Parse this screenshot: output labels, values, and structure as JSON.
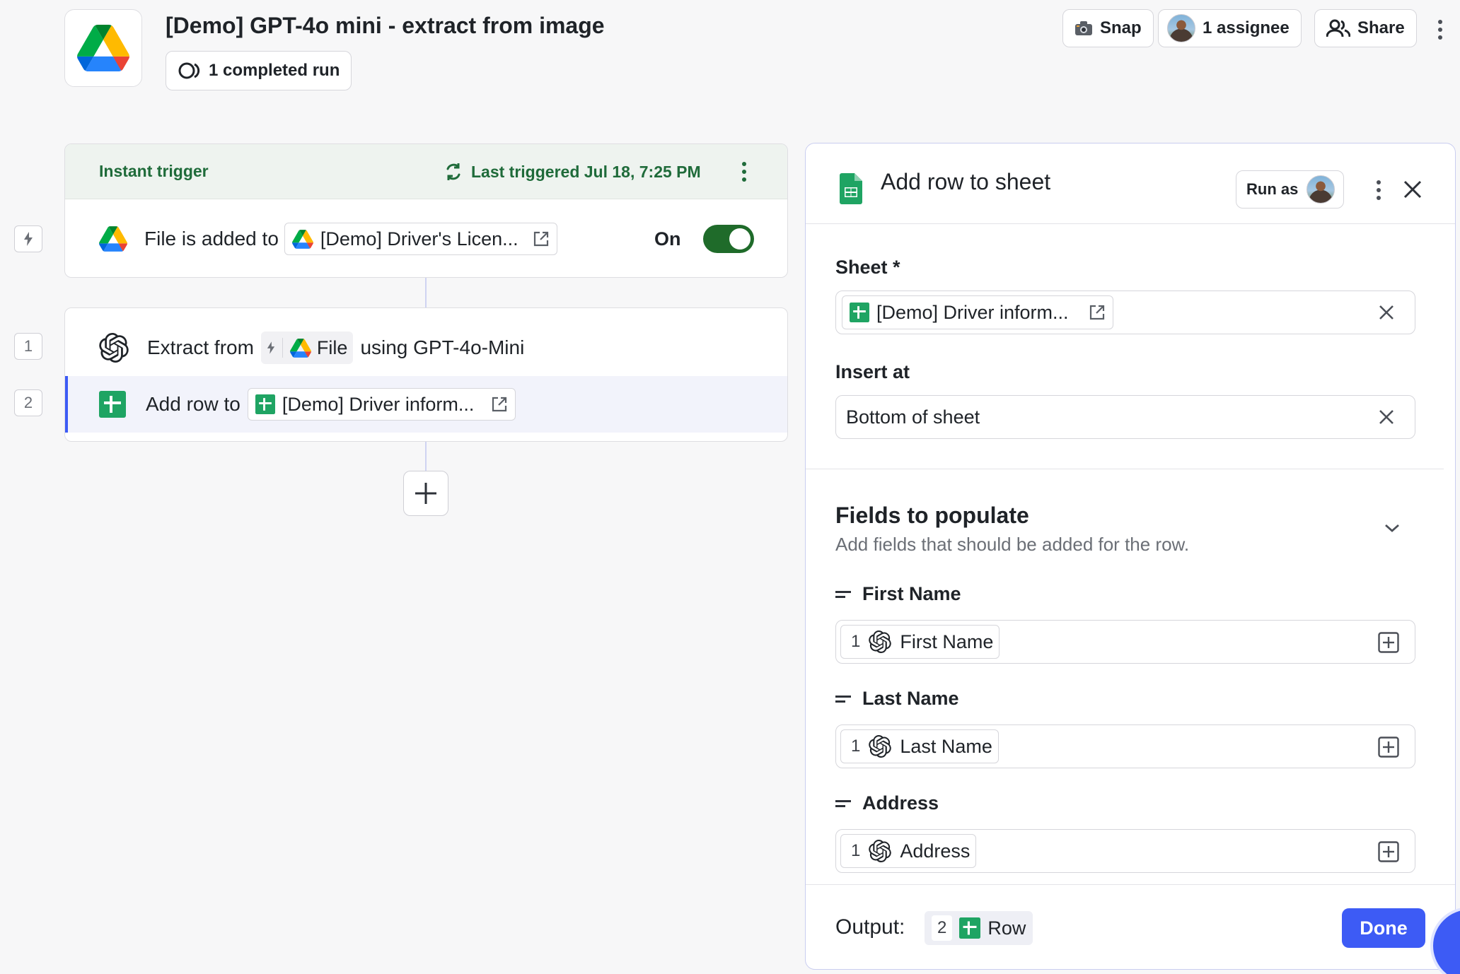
{
  "header": {
    "title": "[Demo] GPT-4o mini - extract from image",
    "runs_label": "1 completed run",
    "snap_label": "Snap",
    "assignee_label": "1 assignee",
    "share_label": "Share"
  },
  "trigger": {
    "label": "Instant trigger",
    "last_triggered": "Last triggered Jul 18, 7:25 PM",
    "step_text": "File is added to",
    "folder_chip": "[Demo] Driver's Licen...",
    "toggle_label": "On",
    "toggle_on": true
  },
  "steps": [
    {
      "number": "1",
      "prefix": "Extract from",
      "chip_label": "File",
      "suffix": "using GPT-4o-Mini"
    },
    {
      "number": "2",
      "prefix": "Add row to",
      "chip_label": "[Demo] Driver inform...",
      "active": true
    }
  ],
  "panel": {
    "title": "Add row to sheet",
    "run_as_label": "Run as",
    "sheet_label": "Sheet *",
    "sheet_value": "[Demo] Driver inform...",
    "insert_label": "Insert at",
    "insert_value": "Bottom of sheet",
    "section_title": "Fields to populate",
    "section_subtitle": "Add fields that should be added for the row.",
    "fields": [
      {
        "label": "First Name",
        "token_num": "1",
        "token_label": "First Name"
      },
      {
        "label": "Last Name",
        "token_num": "1",
        "token_label": "Last Name"
      },
      {
        "label": "Address",
        "token_num": "1",
        "token_label": "Address"
      }
    ],
    "output_label": "Output:",
    "output_num": "2",
    "output_chip": "Row",
    "done_label": "Done"
  },
  "colors": {
    "accent": "#3d5bf5",
    "trigger_green": "#1f6b3a",
    "toggle_green": "#1f6b2a",
    "sheets_green": "#1fa463"
  },
  "icons": [
    "google-drive-icon",
    "lightning-icon",
    "openai-icon",
    "google-sheets-icon",
    "external-link-icon",
    "refresh-icon",
    "close-icon",
    "chevron-down-icon",
    "equals-icon",
    "plus-icon",
    "camera-icon",
    "people-icon",
    "kebab-icon"
  ]
}
